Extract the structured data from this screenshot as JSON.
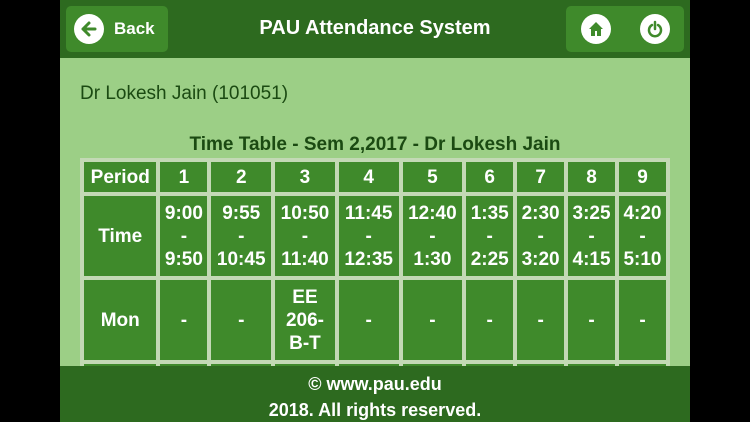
{
  "header": {
    "back_label": "Back",
    "title": "PAU Attendance System",
    "icons": [
      "arrow-left-icon",
      "home-icon",
      "power-icon"
    ]
  },
  "user": {
    "name_line": "Dr Lokesh Jain (101051)"
  },
  "timetable": {
    "title": "Time Table - Sem 2,2017 - Dr Lokesh Jain",
    "period_label": "Period",
    "periods": [
      "1",
      "2",
      "3",
      "4",
      "5",
      "6",
      "7",
      "8",
      "9"
    ],
    "time_label": "Time",
    "times": [
      {
        "start": "9:00",
        "sep": "-",
        "end": "9:50"
      },
      {
        "start": "9:55",
        "sep": "-",
        "end": "10:45"
      },
      {
        "start": "10:50",
        "sep": "-",
        "end": "11:40"
      },
      {
        "start": "11:45",
        "sep": "-",
        "end": "12:35"
      },
      {
        "start": "12:40",
        "sep": "-",
        "end": "1:30"
      },
      {
        "start": "1:35",
        "sep": "-",
        "end": "2:25"
      },
      {
        "start": "2:30",
        "sep": "-",
        "end": "3:20"
      },
      {
        "start": "3:25",
        "sep": "-",
        "end": "4:15"
      },
      {
        "start": "4:20",
        "sep": "-",
        "end": "5:10"
      }
    ],
    "rows": [
      {
        "day": "Mon",
        "cells": [
          "-",
          "-",
          [
            "EE",
            "206-",
            "B-T"
          ],
          "-",
          "-",
          "-",
          "-",
          "-",
          "-"
        ]
      }
    ]
  },
  "footer": {
    "line1": "© www.pau.edu",
    "line2": "2018. All rights reserved."
  }
}
